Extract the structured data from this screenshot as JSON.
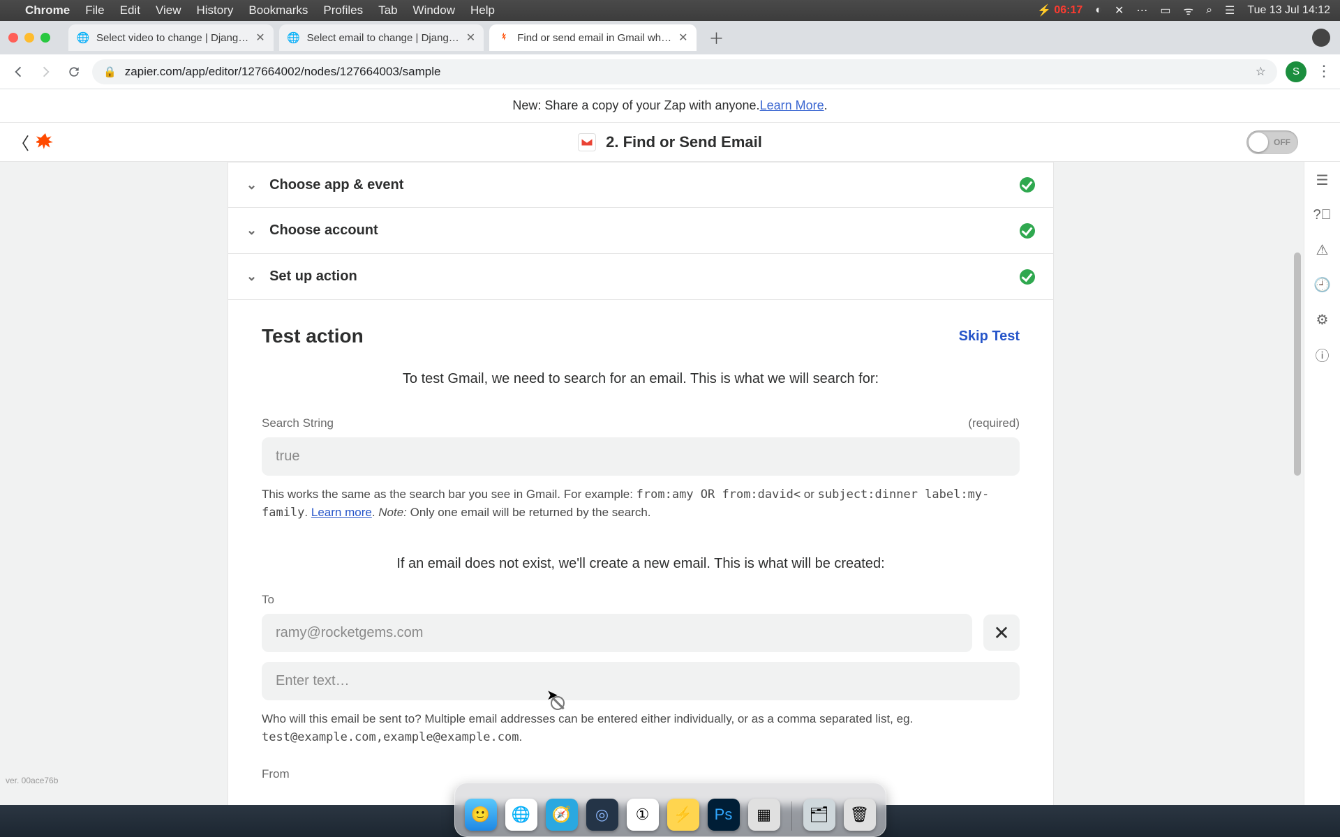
{
  "menubar": {
    "app": "Chrome",
    "items": [
      "File",
      "Edit",
      "View",
      "History",
      "Bookmarks",
      "Profiles",
      "Tab",
      "Window",
      "Help"
    ],
    "battery_time": "06:17",
    "clock": "Tue 13 Jul  14:12"
  },
  "tabs": [
    {
      "title": "Select video to change | Djang…",
      "active": false,
      "favicon": "globe"
    },
    {
      "title": "Select email to change | Djang…",
      "active": false,
      "favicon": "globe"
    },
    {
      "title": "Find or send email in Gmail wh…",
      "active": true,
      "favicon": "zapier"
    }
  ],
  "omnibox": {
    "url": "zapier.com/app/editor/127664002/nodes/127664003/sample"
  },
  "profile_initial": "S",
  "announcement": {
    "text_prefix": "New: Share a copy of your Zap with anyone. ",
    "link": "Learn More",
    "text_suffix": "."
  },
  "zap_header": {
    "step_label": "2. Find or Send Email",
    "toggle": "OFF"
  },
  "steps": [
    {
      "label": "Choose app & event"
    },
    {
      "label": "Choose account"
    },
    {
      "label": "Set up action"
    }
  ],
  "test": {
    "heading": "Test action",
    "skip": "Skip Test",
    "lead": "To test Gmail, we need to search for an email. This is what we will search for:",
    "search": {
      "label": "Search String",
      "required": "(required)",
      "value": "true",
      "help_pre": "This works the same as the search bar you see in Gmail. For example: ",
      "help_code1": "from:amy OR from:david<",
      "help_or": " or ",
      "help_code2": "subject:dinner label:my-family",
      "help_post": ". ",
      "learn_more": "Learn more",
      "note_label": "Note:",
      "note_text": " Only one email will be returned by the search."
    },
    "lead2": "If an email does not exist, we'll create a new email. This is what will be created:",
    "to": {
      "label": "To",
      "value": "ramy@rocketgems.com",
      "placeholder": "Enter text…",
      "help_pre": "Who will this email be sent to? Multiple email addresses can be entered either individually, or as a comma separated list, eg. ",
      "help_code": "test@example.com,example@example.com",
      "help_post": "."
    },
    "from": {
      "label": "From"
    }
  },
  "version": "ver. 00ace76b",
  "dock": [
    "finder",
    "chrome",
    "safari",
    "circle",
    "1pass",
    "bolt",
    "photoshop",
    "launchpad",
    "stacks",
    "trash"
  ]
}
